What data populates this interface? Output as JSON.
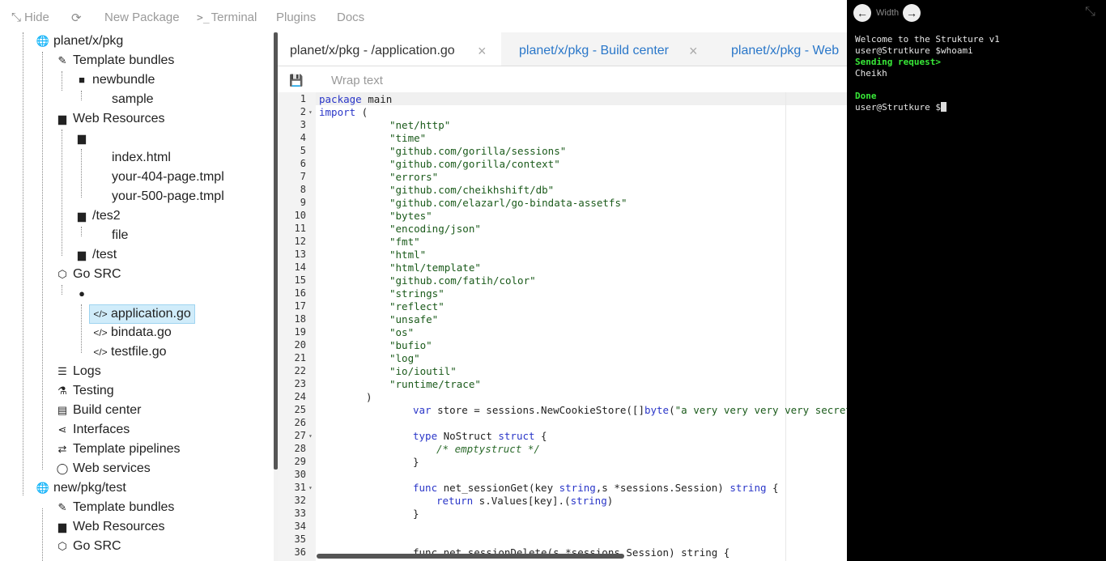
{
  "toolbar": {
    "hide": "Hide",
    "refresh_icon": "refresh-icon",
    "new_package": "New Package",
    "terminal": "Terminal",
    "plugins": "Plugins",
    "docs": "Docs"
  },
  "tree": {
    "pkg1": "planet/x/pkg",
    "template_bundles": "Template bundles",
    "newbundle": "newbundle",
    "sample": "sample",
    "web_resources": "Web Resources",
    "index_html": "index.html",
    "p404": "your-404-page.tmpl",
    "p500": "your-500-page.tmpl",
    "tes2": "/tes2",
    "file": "file",
    "test": "/test",
    "go_src": "Go SRC",
    "application_go": "application.go",
    "bindata_go": "bindata.go",
    "testfile_go": "testfile.go",
    "logs": "Logs",
    "testing": "Testing",
    "build_center": "Build center",
    "interfaces": "Interfaces",
    "template_pipelines": "Template pipelines",
    "web_services": "Web services",
    "pkg2": "new/pkg/test",
    "template_bundles2": "Template bundles",
    "web_resources2": "Web Resources",
    "go_src2": "Go SRC"
  },
  "tabs": [
    {
      "label": "planet/x/pkg - /application.go",
      "close": "×"
    },
    {
      "label": "planet/x/pkg - Build center",
      "close": "×"
    },
    {
      "label": "planet/x/pkg - Web",
      "close": ""
    }
  ],
  "editor": {
    "wrap_text": "Wrap text",
    "line_numbers": [
      "1",
      "2",
      "3",
      "4",
      "5",
      "6",
      "7",
      "8",
      "9",
      "10",
      "11",
      "12",
      "13",
      "14",
      "15",
      "16",
      "17",
      "18",
      "19",
      "20",
      "21",
      "22",
      "23",
      "24",
      "25",
      "26",
      "27",
      "28",
      "29",
      "30",
      "31",
      "32",
      "33",
      "34",
      "35",
      "36"
    ],
    "imports": [
      "\"net/http\"",
      "\"time\"",
      "\"github.com/gorilla/sessions\"",
      "\"github.com/gorilla/context\"",
      "\"errors\"",
      "\"github.com/cheikhshift/db\"",
      "\"github.com/elazarl/go-bindata-assetfs\"",
      "\"bytes\"",
      "\"encoding/json\"",
      "\"fmt\"",
      "\"html\"",
      "\"html/template\"",
      "\"github.com/fatih/color\"",
      "\"strings\"",
      "\"reflect\"",
      "\"unsafe\"",
      "\"os\"",
      "\"bufio\"",
      "\"log\"",
      "\"io/ioutil\"",
      "\"runtime/trace\""
    ],
    "kw_package": "package",
    "id_main": " main",
    "kw_import": "import",
    "paren_open": " (",
    "paren_close": ")",
    "l25_kw": "var",
    "l25_a": " store = sessions.NewCookieStore([]",
    "l25_kw2": "byte",
    "l25_b": "(",
    "l25_str": "\"a very very very very secret ke",
    "l27_kw": "type",
    "l27_a": " NoStruct ",
    "l27_kw2": "struct",
    "l27_b": " {",
    "l28_cm": "/* emptystruct */",
    "l29": "}",
    "l31_kw": "func",
    "l31_a": " net_sessionGet(key ",
    "l31_t1": "string",
    "l31_b": ",s *sessions.Session) ",
    "l31_t2": "string",
    "l31_c": " {",
    "l32_kw": "return",
    "l32_a": " s.Values[key].(",
    "l32_t": "string",
    "l32_b": ")",
    "l33": "}",
    "l36": "func net_sessionDelete(s *sessions.Session) string {"
  },
  "terminal": {
    "width_label": "Width",
    "lines": [
      {
        "text": "Welcome to the Strukture v1",
        "green": false
      },
      {
        "text": "user@Strutkure $whoami",
        "green": false
      },
      {
        "text": "Sending request>",
        "green": true
      },
      {
        "text": "Cheikh",
        "green": false
      },
      {
        "text": "",
        "green": false
      },
      {
        "text": "Done",
        "green": true
      }
    ],
    "prompt": "user@Strutkure $"
  }
}
